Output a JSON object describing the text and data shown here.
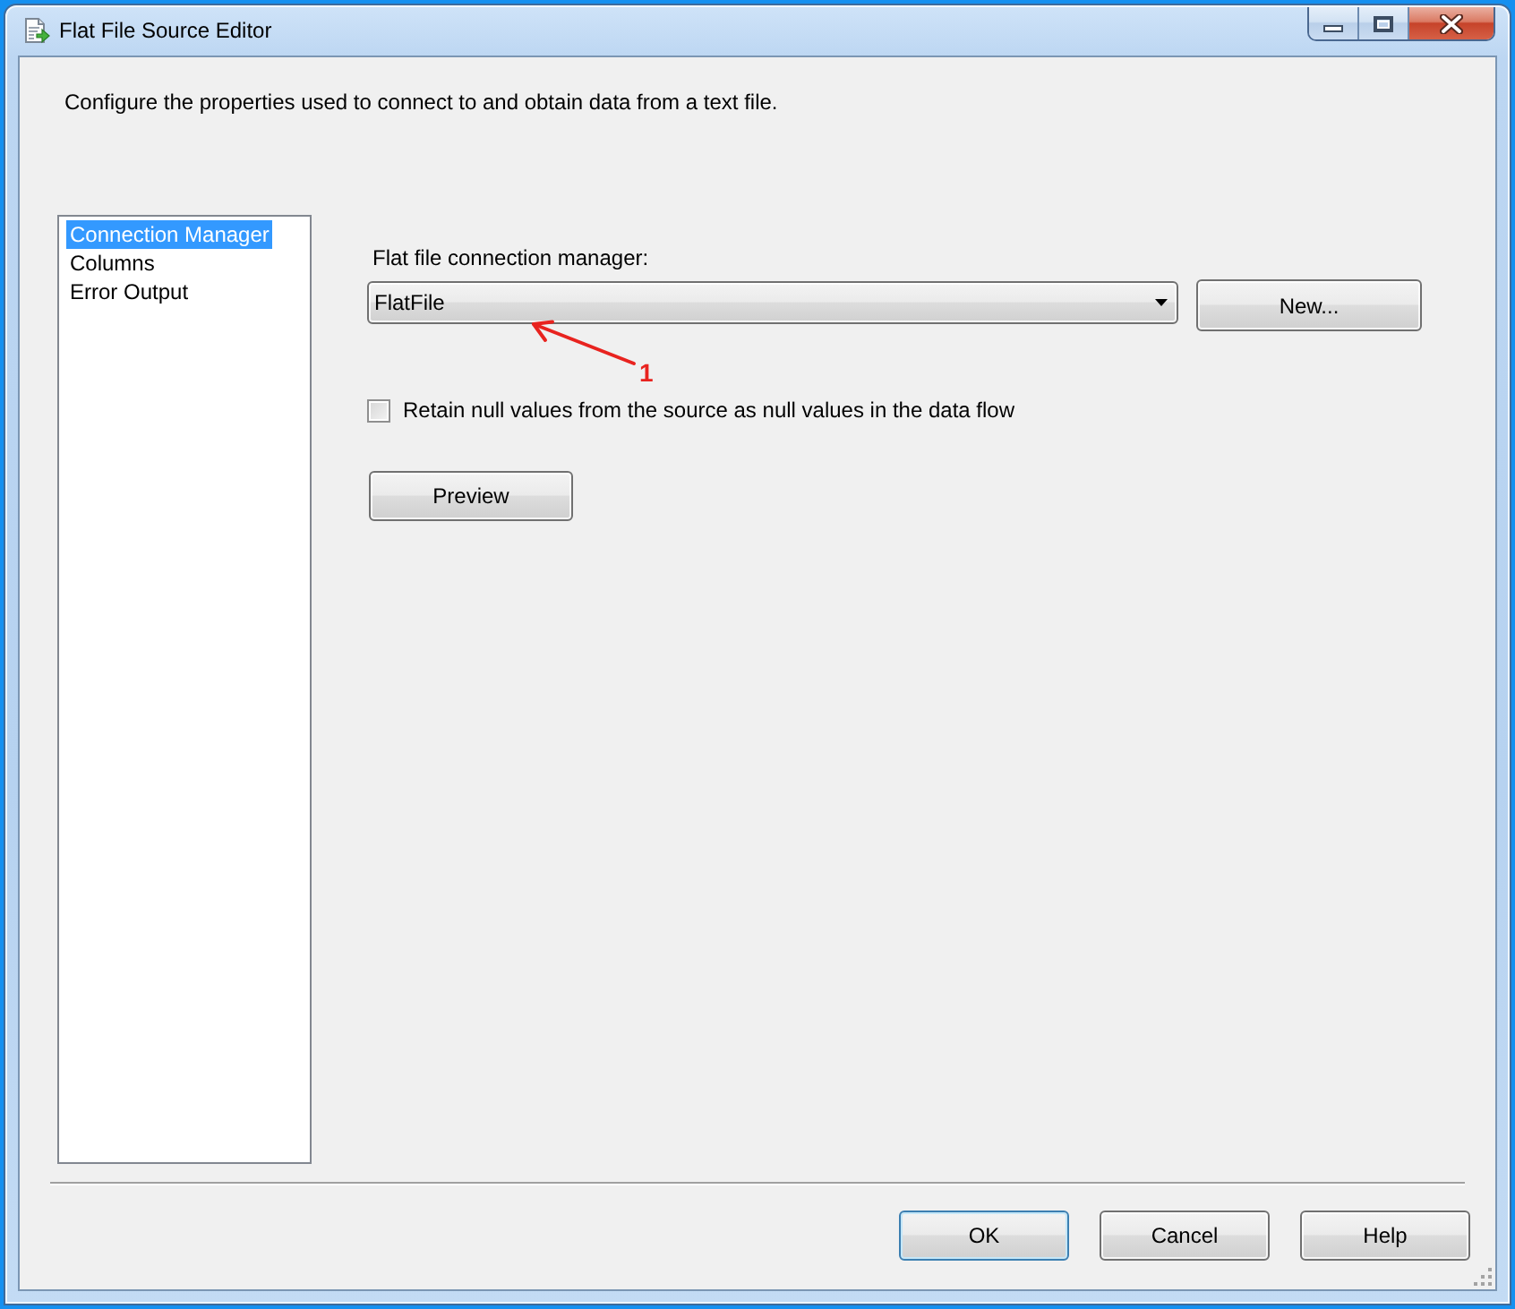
{
  "window": {
    "title": "Flat File Source Editor"
  },
  "description": "Configure the properties used to connect to and obtain data from a text file.",
  "sidebar": {
    "items": [
      {
        "label": "Connection Manager",
        "selected": true
      },
      {
        "label": "Columns",
        "selected": false
      },
      {
        "label": "Error Output",
        "selected": false
      }
    ]
  },
  "connection_manager": {
    "label": "Flat file connection manager:",
    "value": "FlatFile",
    "new_button": "New..."
  },
  "annotation": {
    "label": "1"
  },
  "retain_nulls": {
    "label": "Retain null values from the source as null values in the data flow",
    "checked": false
  },
  "preview_button": "Preview",
  "buttons": [
    {
      "label": "OK",
      "focused": true
    },
    {
      "label": "Cancel",
      "focused": false
    },
    {
      "label": "Help",
      "focused": false
    }
  ]
}
